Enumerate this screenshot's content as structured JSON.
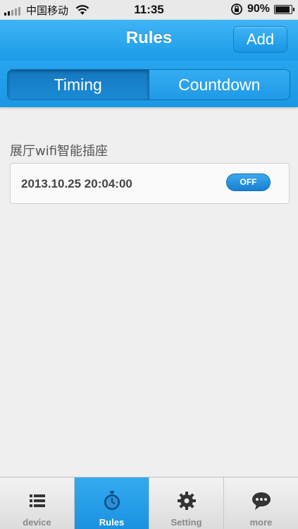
{
  "status_bar": {
    "carrier": "中国移动",
    "time": "11:35",
    "battery": "90%",
    "battery_level": 0.9
  },
  "navbar": {
    "title": "Rules",
    "add_label": "Add"
  },
  "segments": [
    {
      "label": "Timing",
      "active": true
    },
    {
      "label": "Countdown",
      "active": false
    }
  ],
  "rules": {
    "device_name": "展厅wifi智能插座",
    "items": [
      {
        "time": "2013.10.25 20:04:00",
        "state": "OFF"
      }
    ]
  },
  "tabbar": {
    "items": [
      {
        "label": "device",
        "icon": "list-icon"
      },
      {
        "label": "Rules",
        "icon": "stopwatch-icon",
        "active": true
      },
      {
        "label": "Setting",
        "icon": "gear-icon"
      },
      {
        "label": "more",
        "icon": "chat-bubble-icon"
      }
    ]
  },
  "colors": {
    "accent": "#1c9be8",
    "background": "#efefef"
  }
}
